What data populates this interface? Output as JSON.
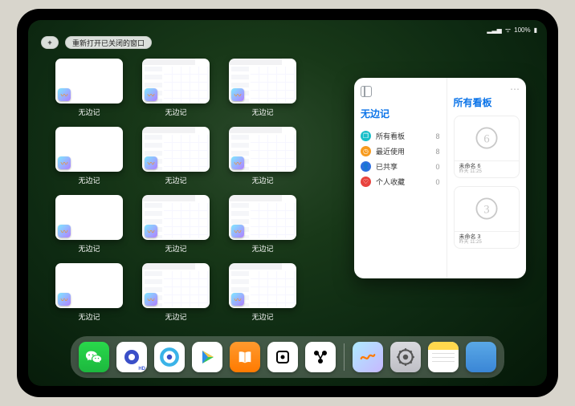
{
  "status": {
    "battery": "100%"
  },
  "toolbar": {
    "add_label": "+",
    "reopen_label": "重新打开已关闭的窗口"
  },
  "app_name": "无边记",
  "switcher": {
    "rows": [
      [
        {
          "label": "无边记",
          "variant": "blank"
        },
        {
          "label": "无边记",
          "variant": "grid"
        },
        {
          "label": "无边记",
          "variant": "grid"
        }
      ],
      [
        {
          "label": "无边记",
          "variant": "blank"
        },
        {
          "label": "无边记",
          "variant": "grid"
        },
        {
          "label": "无边记",
          "variant": "grid"
        }
      ],
      [
        {
          "label": "无边记",
          "variant": "blank"
        },
        {
          "label": "无边记",
          "variant": "grid"
        },
        {
          "label": "无边记",
          "variant": "grid"
        }
      ],
      [
        {
          "label": "无边记",
          "variant": "blank"
        },
        {
          "label": "无边记",
          "variant": "grid"
        },
        {
          "label": "无边记",
          "variant": "grid"
        }
      ]
    ]
  },
  "panel": {
    "title": "无边记",
    "right_title": "所有看板",
    "categories": [
      {
        "icon": "cyan",
        "label": "所有看板",
        "count": "8"
      },
      {
        "icon": "orange",
        "label": "最近使用",
        "count": "8"
      },
      {
        "icon": "blue",
        "label": "已共享",
        "count": "0"
      },
      {
        "icon": "red",
        "label": "个人收藏",
        "count": "0"
      }
    ],
    "boards": [
      {
        "name": "未命名 6",
        "time": "昨天 11:25",
        "glyph": "6"
      },
      {
        "name": "未命名 3",
        "time": "昨天 11:25",
        "glyph": "3"
      }
    ]
  },
  "dock": {
    "items": [
      {
        "name": "wechat"
      },
      {
        "name": "quark-hd"
      },
      {
        "name": "quark"
      },
      {
        "name": "play"
      },
      {
        "name": "books"
      },
      {
        "name": "dice"
      },
      {
        "name": "nodes"
      }
    ],
    "recent": [
      {
        "name": "freeform"
      },
      {
        "name": "settings"
      },
      {
        "name": "notes"
      },
      {
        "name": "app-library"
      }
    ]
  }
}
